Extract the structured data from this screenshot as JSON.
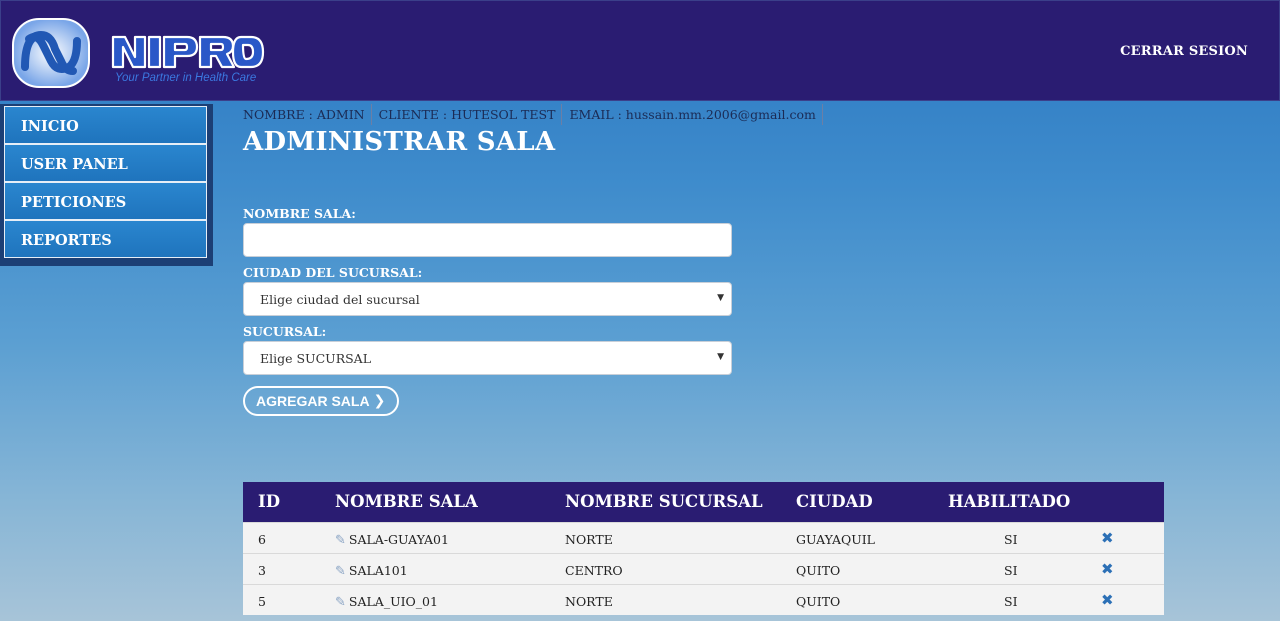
{
  "header": {
    "brand": "NIPRO",
    "tagline": "Your Partner in Health Care",
    "logout_label": "CERRAR SESION"
  },
  "sidebar": {
    "items": [
      {
        "label": "INICIO"
      },
      {
        "label": "USER PANEL"
      },
      {
        "label": "PETICIONES"
      },
      {
        "label": "REPORTES"
      }
    ]
  },
  "info": {
    "nombre": "NOMBRE : ADMIN",
    "cliente": "CLIENTE : HUTESOL TEST",
    "email": "EMAIL : hussain.mm.2006@gmail.com"
  },
  "page_title": "ADMINISTRAR SALA",
  "form": {
    "nombre_label": "NOMBRE SALA:",
    "nombre_value": "",
    "ciudad_label": "CIUDAD DEL SUCURSAL:",
    "ciudad_selected": "Elige ciudad del sucursal",
    "sucursal_label": "SUCURSAL:",
    "sucursal_selected": "Elige SUCURSAL",
    "submit_label": "AGREGAR SALA"
  },
  "table": {
    "headers": [
      "ID",
      "NOMBRE SALA",
      "NOMBRE SUCURSAL",
      "CIUDAD",
      "HABILITADO"
    ],
    "rows": [
      {
        "id": "6",
        "nombre": "SALA-GUAYA01",
        "sucursal": "NORTE",
        "ciudad": "GUAYAQUIL",
        "habilitado": "SI"
      },
      {
        "id": "3",
        "nombre": "SALA101",
        "sucursal": "CENTRO",
        "ciudad": "QUITO",
        "habilitado": "SI"
      },
      {
        "id": "5",
        "nombre": "SALA_UIO_01",
        "sucursal": "NORTE",
        "ciudad": "QUITO",
        "habilitado": "SI"
      }
    ]
  },
  "colors": {
    "header_bg": "#2a1c72",
    "nav_bg": "#2a86cf",
    "delete_icon": "#2c70b6"
  },
  "icons": {
    "edit": "pencil-icon",
    "delete": "close-icon",
    "submit": "chevron-right-icon"
  }
}
